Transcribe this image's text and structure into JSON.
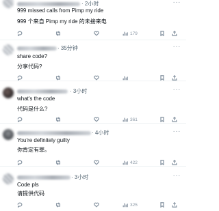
{
  "posts": [
    {
      "time": "· 2小时",
      "lines": [
        "999 missed calls from Pimp my ride",
        "999 个来自 Pimp my ride 的未接来电"
      ],
      "views": "179"
    },
    {
      "time": "· 35分钟",
      "lines": [
        "share code?",
        "分享代码?"
      ],
      "views": ""
    },
    {
      "time": "· 3小时",
      "lines": [
        "what's the code",
        "代码是什么?"
      ],
      "views": "361"
    },
    {
      "time": "· 4小时",
      "lines": [
        "You're definitely guilty",
        "你肯定有罪。"
      ],
      "views": "422"
    },
    {
      "time": "· 3小时",
      "lines": [
        "Code pls",
        "请提供代码"
      ],
      "views": "325"
    }
  ],
  "more_glyph": "···",
  "icons": [
    "reply-icon",
    "retweet-icon",
    "like-icon",
    "views-icon",
    "bookmark-icon",
    "share-icon"
  ]
}
